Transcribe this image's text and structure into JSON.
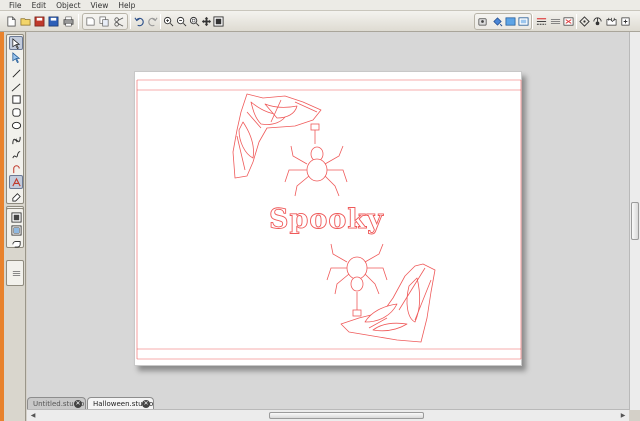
{
  "menubar": {
    "items": [
      "File",
      "Edit",
      "Object",
      "View",
      "Help"
    ]
  },
  "toolbar": {
    "left_icons": [
      "new-file-icon",
      "open-folder-icon",
      "save-icon",
      "save-as-icon",
      "print-icon",
      "cut-icon",
      "copy-icon",
      "paste-icon",
      "undo-icon",
      "redo-icon",
      "zoom-in-icon",
      "zoom-out-icon",
      "zoom-selection-icon",
      "pan-icon",
      "fit-to-window-icon"
    ],
    "right_icons": [
      "cutter-icon",
      "fill-icon",
      "line-style-icon",
      "page-setup-icon",
      "replicate-icon",
      "offset-icon",
      "transform-icon",
      "trace-icon",
      "cut-settings-icon",
      "store-icon",
      "send-to-cutter-icon"
    ]
  },
  "sidebar": {
    "tools": [
      "select-tool-icon",
      "point-edit-tool-icon",
      "line-tool-icon",
      "polygon-tool-icon",
      "rectangle-tool-icon",
      "rounded-rectangle-tool-icon",
      "ellipse-tool-icon",
      "curve-tool-icon",
      "freehand-tool-icon",
      "arc-tool-icon",
      "text-tool-icon",
      "eraser-tool-icon",
      "knife-tool-icon",
      "fill-panel-icon",
      "layers-icon",
      "library-icon",
      "sidebar-toggle-icon"
    ]
  },
  "design": {
    "text": "Spooky",
    "stroke_color": "#ef5a5a"
  },
  "tabs": [
    {
      "label": "Untitled.studio",
      "active": false
    },
    {
      "label": "Halloween.studio",
      "active": true
    }
  ],
  "colors": {
    "accent": "#e8822c",
    "cut_line": "#ef5a5a"
  }
}
